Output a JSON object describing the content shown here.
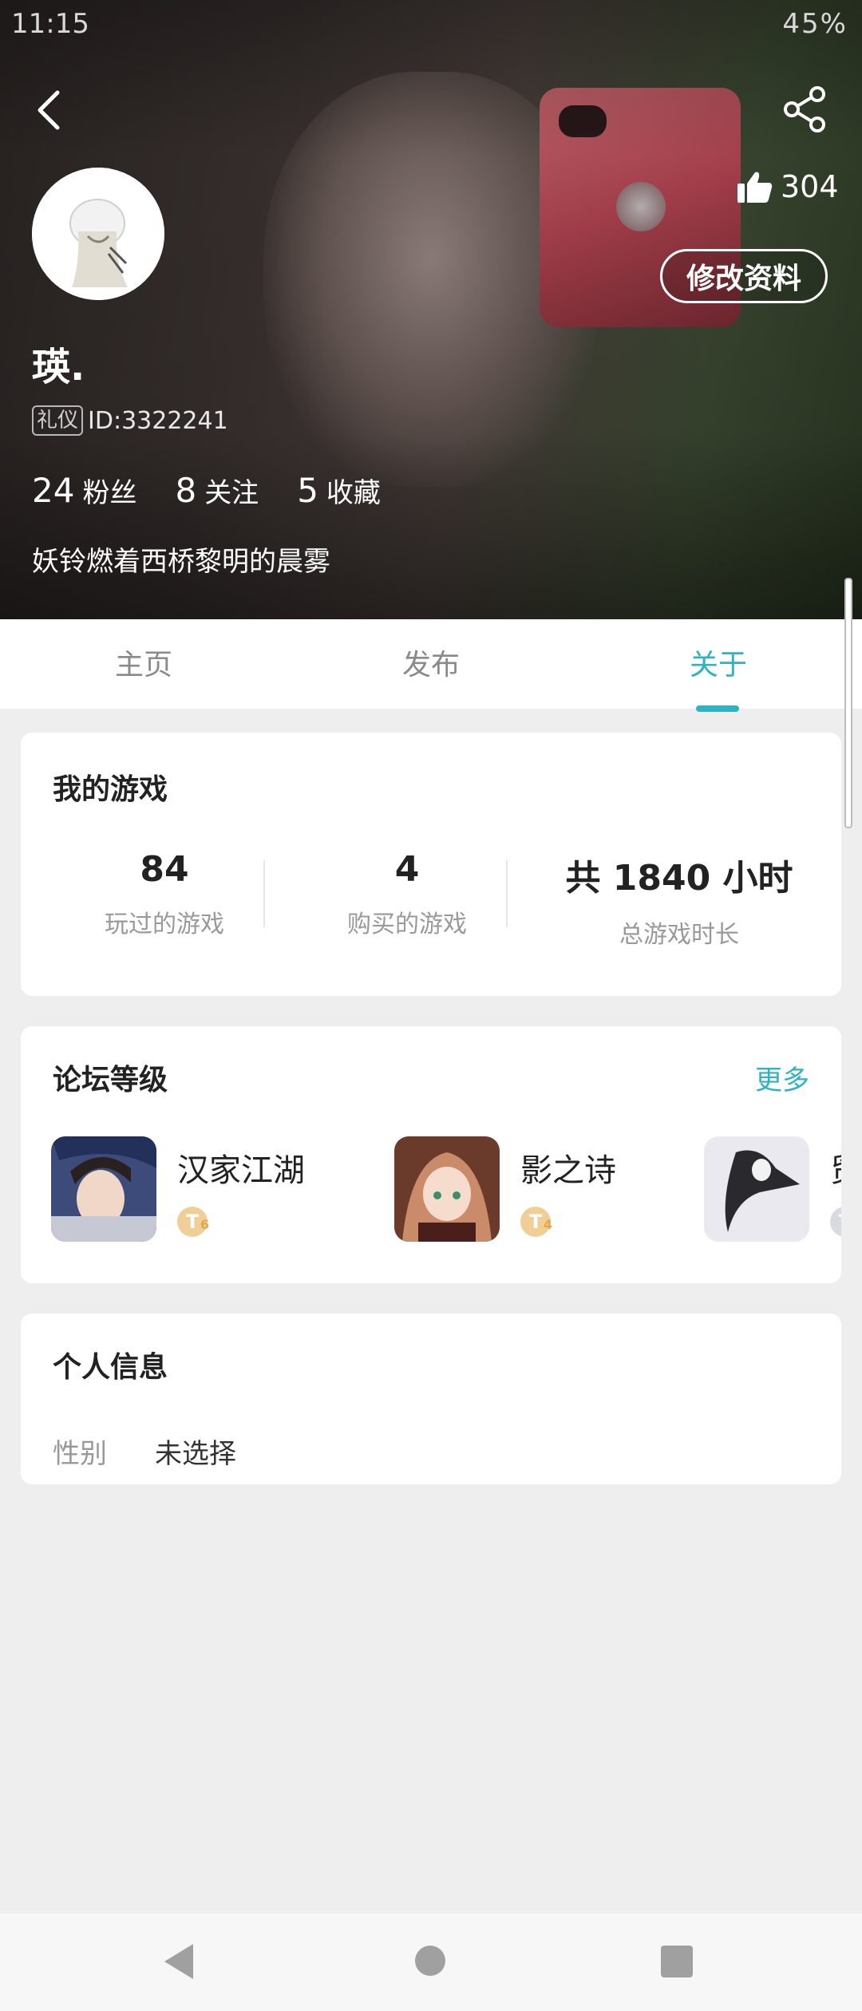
{
  "status_bar": {
    "time": "11:15",
    "right": "⏰ 📳 VoLTE 4G ▲ ▲ ▮ 45%",
    "battery": "45%"
  },
  "profile": {
    "likes": "304",
    "edit_label": "修改资料",
    "name": "瑛.",
    "badge": "礼仪",
    "id_text": "ID:3322241",
    "stats": [
      {
        "num": "24",
        "label": "粉丝"
      },
      {
        "num": "8",
        "label": "关注"
      },
      {
        "num": "5",
        "label": "收藏"
      }
    ],
    "bio": "妖铃燃着西桥黎明的晨雾"
  },
  "tabs": [
    {
      "label": "主页"
    },
    {
      "label": "发布"
    },
    {
      "label": "关于"
    }
  ],
  "active_tab": "关于",
  "my_games": {
    "title": "我的游戏",
    "stats": [
      {
        "value": "84",
        "label": "玩过的游戏"
      },
      {
        "value": "4",
        "label": "购买的游戏"
      },
      {
        "value": "共 1840 小时",
        "label": "总游戏时长"
      }
    ]
  },
  "forum_level": {
    "title": "论坛等级",
    "more": "更多",
    "items": [
      {
        "name": "汉家江湖",
        "level": "6"
      },
      {
        "name": "影之诗",
        "level": "4"
      },
      {
        "name": "贸",
        "level": ""
      }
    ]
  },
  "personal_info": {
    "title": "个人信息",
    "gender_label": "性别",
    "gender_value": "未选择"
  },
  "colors": {
    "accent": "#2fb3c4",
    "background": "#eeeeee",
    "card": "#ffffff"
  }
}
